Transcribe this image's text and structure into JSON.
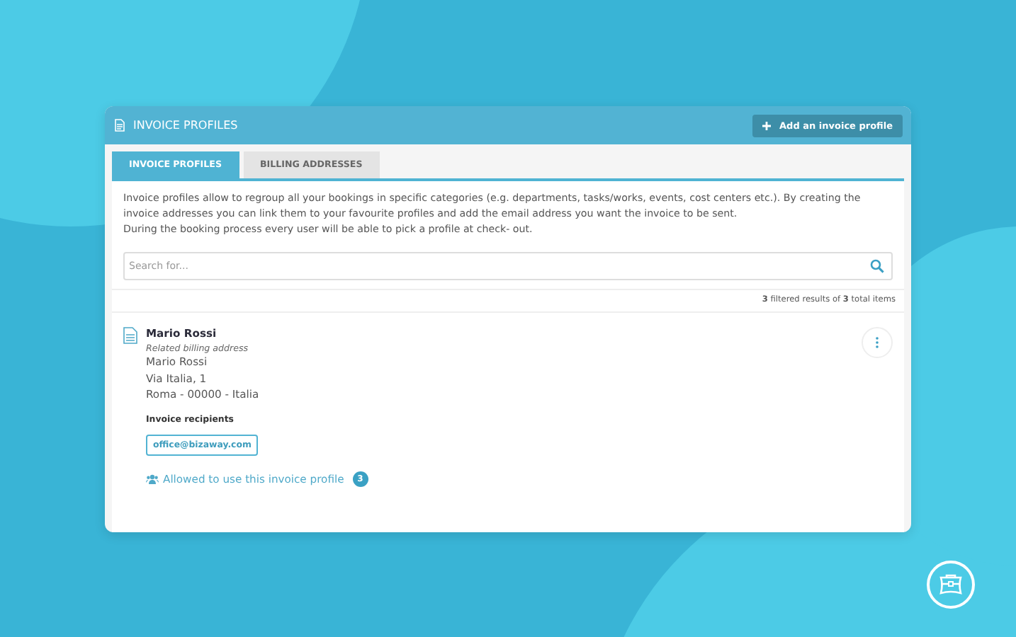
{
  "header": {
    "title": "INVOICE PROFILES",
    "add_button": "Add an invoice profile"
  },
  "tabs": [
    {
      "label": "INVOICE PROFILES",
      "selected": true
    },
    {
      "label": "BILLING ADDRESSES",
      "selected": false
    }
  ],
  "description": [
    "Invoice profiles allow to regroup all your bookings in specific categories (e.g. departments, tasks/works, events, cost centers etc.). By creating the invoice addresses you can link them to your favourite profiles and add the email address you want the invoice to be sent.",
    "During the booking process every user will be able to pick a profile at check- out."
  ],
  "search": {
    "placeholder": "Search for..."
  },
  "results": "**3** filtered results of **3** total items",
  "profiles": [
    {
      "name": "Mario Rossi",
      "billing_label": "Related billing address",
      "address_lines": [
        "Mario Rossi",
        "Via Italia, 1",
        "Roma - 00000 - Italia"
      ],
      "recipients_label": "Invoice recipients",
      "recipients": [
        "office@bizaway.com"
      ],
      "allowed_link": "Allowed to use this invoice profile",
      "allowed_count": "3"
    }
  ]
}
